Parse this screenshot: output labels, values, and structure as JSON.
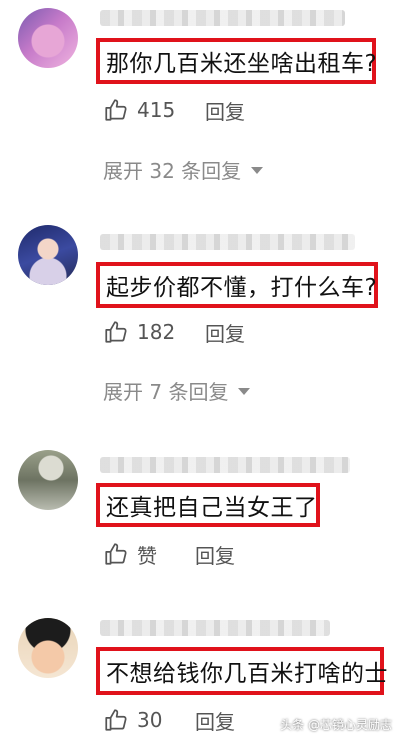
{
  "comments": [
    {
      "text": "那你几百米还坐啥出租车?",
      "likes": "415",
      "reply_label": "回复",
      "expand_label": "展开 32 条回复"
    },
    {
      "text": "起步价都不懂，打什么车?",
      "likes": "182",
      "reply_label": "回复",
      "expand_label": "展开 7 条回复"
    },
    {
      "text": "还真把自己当女王了",
      "likes": "赞",
      "reply_label": "回复"
    },
    {
      "text": "不想给钱你几百米打啥的士",
      "likes": "30",
      "reply_label": "回复"
    }
  ],
  "watermark": "头条 @芯镜心灵励志",
  "icons": {
    "like": "thumbs-up-icon",
    "expand": "caret-down-icon"
  },
  "colors": {
    "highlight_border": "#e0121b",
    "muted_text": "#8a8a8a"
  }
}
